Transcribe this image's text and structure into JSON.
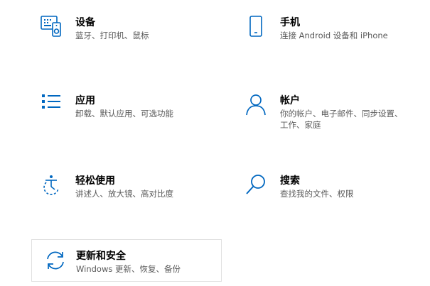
{
  "accent_color": "#0067c0",
  "tiles": [
    {
      "title": "设备",
      "desc": "蓝牙、打印机、鼠标",
      "icon": "devices-icon"
    },
    {
      "title": "手机",
      "desc": "连接 Android 设备和 iPhone",
      "icon": "phone-icon"
    },
    {
      "title": "应用",
      "desc": "卸载、默认应用、可选功能",
      "icon": "apps-icon"
    },
    {
      "title": "帐户",
      "desc": "你的帐户、电子邮件、同步设置、工作、家庭",
      "icon": "person-icon"
    },
    {
      "title": "轻松使用",
      "desc": "讲述人、放大镜、高对比度",
      "icon": "ease-of-access-icon"
    },
    {
      "title": "搜索",
      "desc": "查找我的文件、权限",
      "icon": "search-icon"
    },
    {
      "title": "更新和安全",
      "desc": "Windows 更新、恢复、备份",
      "icon": "update-sync-icon"
    }
  ]
}
